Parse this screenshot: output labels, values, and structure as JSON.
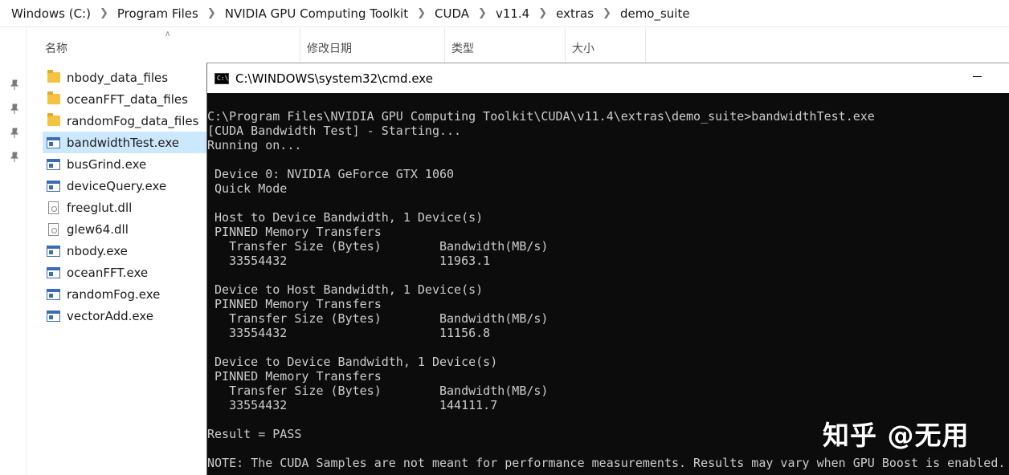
{
  "breadcrumb": [
    "Windows (C:)",
    "Program Files",
    "NVIDIA GPU Computing Toolkit",
    "CUDA",
    "v11.4",
    "extras",
    "demo_suite"
  ],
  "columns": {
    "name": "名称",
    "date": "修改日期",
    "type": "类型",
    "size": "大小"
  },
  "files": [
    {
      "name": "nbody_data_files",
      "icon": "folder-icon"
    },
    {
      "name": "oceanFFT_data_files",
      "icon": "folder-icon"
    },
    {
      "name": "randomFog_data_files",
      "icon": "folder-icon"
    },
    {
      "name": "bandwidthTest.exe",
      "icon": "exe-icon",
      "selected": true
    },
    {
      "name": "busGrind.exe",
      "icon": "exe-icon"
    },
    {
      "name": "deviceQuery.exe",
      "icon": "exe-icon"
    },
    {
      "name": "freeglut.dll",
      "icon": "dll-icon"
    },
    {
      "name": "glew64.dll",
      "icon": "dll-icon"
    },
    {
      "name": "nbody.exe",
      "icon": "exe-icon"
    },
    {
      "name": "oceanFFT.exe",
      "icon": "exe-icon"
    },
    {
      "name": "randomFog.exe",
      "icon": "exe-icon"
    },
    {
      "name": "vectorAdd.exe",
      "icon": "exe-icon"
    }
  ],
  "cmd": {
    "title": "C:\\WINDOWS\\system32\\cmd.exe",
    "icon_text": "C:\\",
    "lines": [
      "C:\\Program Files\\NVIDIA GPU Computing Toolkit\\CUDA\\v11.4\\extras\\demo_suite>bandwidthTest.exe",
      "[CUDA Bandwidth Test] - Starting...",
      "Running on...",
      "",
      " Device 0: NVIDIA GeForce GTX 1060",
      " Quick Mode",
      "",
      " Host to Device Bandwidth, 1 Device(s)",
      " PINNED Memory Transfers",
      "   Transfer Size (Bytes)        Bandwidth(MB/s)",
      "   33554432                     11963.1",
      "",
      " Device to Host Bandwidth, 1 Device(s)",
      " PINNED Memory Transfers",
      "   Transfer Size (Bytes)        Bandwidth(MB/s)",
      "   33554432                     11156.8",
      "",
      " Device to Device Bandwidth, 1 Device(s)",
      " PINNED Memory Transfers",
      "   Transfer Size (Bytes)        Bandwidth(MB/s)",
      "   33554432                     144111.7",
      "",
      "Result = PASS",
      "",
      "NOTE: The CUDA Samples are not meant for performance measurements. Results may vary when GPU Boost is enabled."
    ]
  },
  "watermark": "知乎 @无用",
  "colors": {
    "selection": "#cce8ff",
    "console_bg": "#0c0c0c",
    "console_text": "#cccccc",
    "folder": "#f5c242"
  }
}
